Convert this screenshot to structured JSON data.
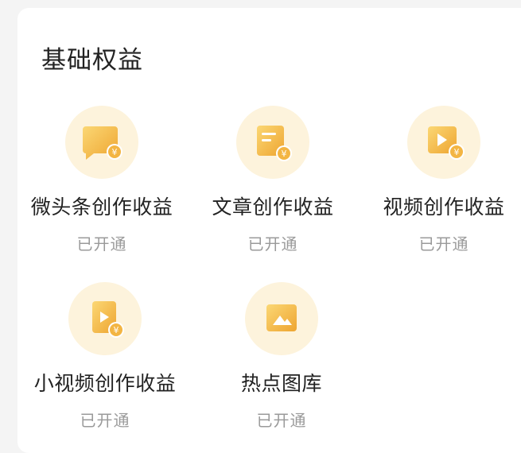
{
  "section": {
    "title": "基础权益"
  },
  "items": [
    {
      "label": "微头条创作收益",
      "status": "已开通",
      "icon": "micro-post-yuan-icon"
    },
    {
      "label": "文章创作收益",
      "status": "已开通",
      "icon": "article-yuan-icon"
    },
    {
      "label": "视频创作收益",
      "status": "已开通",
      "icon": "video-yuan-icon"
    },
    {
      "label": "小视频创作收益",
      "status": "已开通",
      "icon": "short-video-yuan-icon"
    },
    {
      "label": "热点图库",
      "status": "已开通",
      "icon": "image-gallery-icon"
    }
  ],
  "colors": {
    "icon_circle_bg": "#fdf3dc",
    "icon_gold_light": "#fbd774",
    "icon_gold_dark": "#eea531",
    "status_text": "#9a9a9a",
    "label_text": "#222222"
  }
}
